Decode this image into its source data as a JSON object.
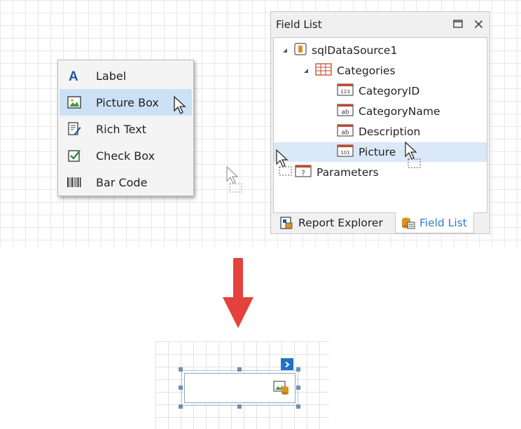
{
  "toolbox": {
    "items": [
      {
        "label": "Label",
        "icon": "label-icon"
      },
      {
        "label": "Picture Box",
        "icon": "picture-box-icon"
      },
      {
        "label": "Rich Text",
        "icon": "rich-text-icon"
      },
      {
        "label": "Check Box",
        "icon": "check-box-icon"
      },
      {
        "label": "Bar Code",
        "icon": "bar-code-icon"
      }
    ],
    "selected_index": 1
  },
  "field_list": {
    "title": "Field List",
    "tree": {
      "datasource": "sqlDataSource1",
      "table": "Categories",
      "fields": [
        {
          "label": "CategoryID",
          "type_badge": "123"
        },
        {
          "label": "CategoryName",
          "type_badge": "ab"
        },
        {
          "label": "Description",
          "type_badge": "ab"
        },
        {
          "label": "Picture",
          "type_badge": "101"
        }
      ],
      "parameters_label": "Parameters",
      "parameters_badge": "?"
    },
    "tabs": [
      {
        "label": "Report Explorer",
        "active": false
      },
      {
        "label": "Field List",
        "active": true
      }
    ]
  },
  "colors": {
    "accent": "#2f7bd1",
    "selection": "#cde1f6",
    "arrow": "#e5413d",
    "smart_tag": "#1f73c6"
  }
}
